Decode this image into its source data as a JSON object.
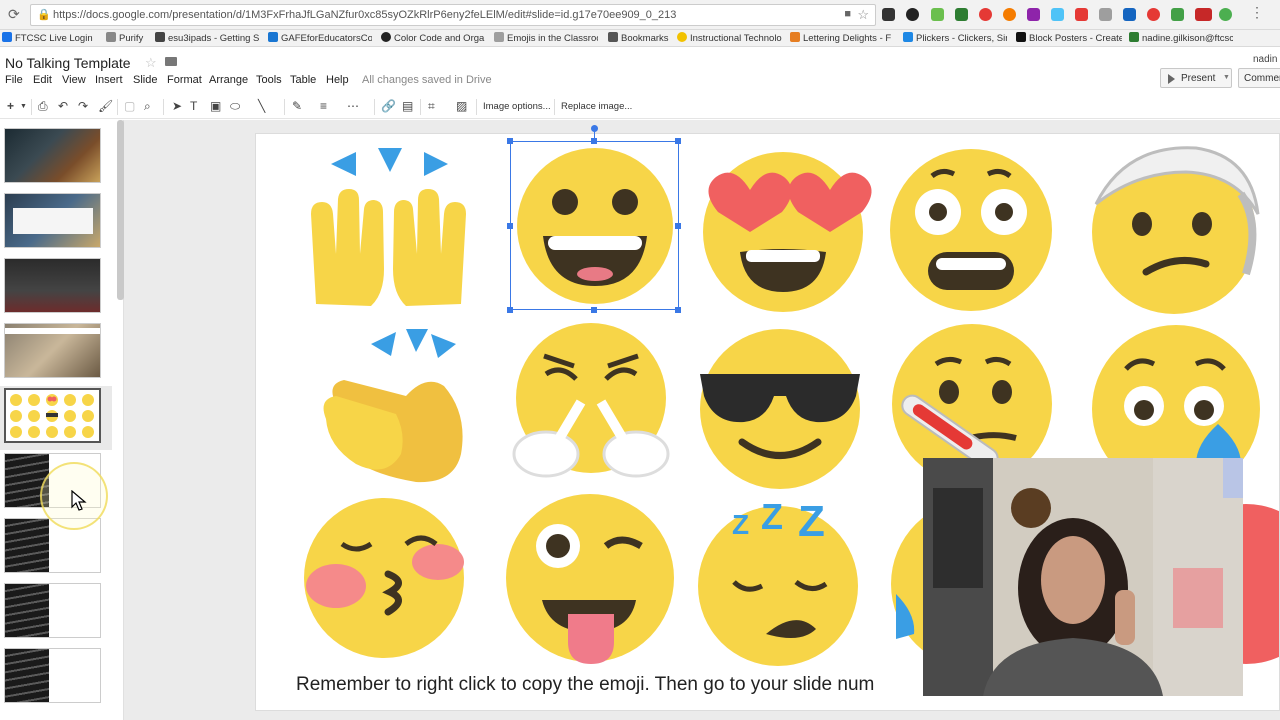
{
  "browser": {
    "url": "https://docs.google.com/presentation/d/1M3FxFrhaJfLGaNZfur0xc85syOZkRlrP6eny2feLElM/edit#slide=id.g17e70ee909_0_213",
    "bookmarks": [
      {
        "label": "FTCSC Live Login",
        "color": "#1a73e8"
      },
      {
        "label": "Purify",
        "color": "#888"
      },
      {
        "label": "esu3ipads - Getting S",
        "color": "#444"
      },
      {
        "label": "GAFEforEducatorsCou",
        "color": "#1976d2"
      },
      {
        "label": "Color Code and Orga",
        "color": "#222"
      },
      {
        "label": "Emojis in the Classroo",
        "color": "#9e9e9e"
      },
      {
        "label": "Bookmarks",
        "color": "#555"
      },
      {
        "label": "Instructional Technolo",
        "color": "#f2c200"
      },
      {
        "label": "Lettering Delights - F",
        "color": "#e67e22"
      },
      {
        "label": "Plickers - Clickers, Sim",
        "color": "#1e88e5"
      },
      {
        "label": "Block Posters - Create",
        "color": "#111"
      },
      {
        "label": "nadine.gilkison@ftcsc",
        "color": "#2e7d32"
      }
    ]
  },
  "doc": {
    "title": "No Talking Template",
    "user": "nadin",
    "saved_status": "All changes saved in Drive",
    "present_label": "Present",
    "comments_label": "Comments"
  },
  "menu": [
    "File",
    "Edit",
    "View",
    "Insert",
    "Slide",
    "Format",
    "Arrange",
    "Tools",
    "Table",
    "Help"
  ],
  "toolbar": {
    "image_options": "Image options...",
    "replace_image": "Replace image..."
  },
  "slide": {
    "caption": "Remember to right click to copy the emoji. Then go to your slide num",
    "selected_emoji": "grinning-face"
  },
  "colors": {
    "emoji_yellow": "#f7d548",
    "selection_blue": "#3a78e6",
    "heart_red": "#f06060",
    "blush_pink": "#f58a8a"
  }
}
